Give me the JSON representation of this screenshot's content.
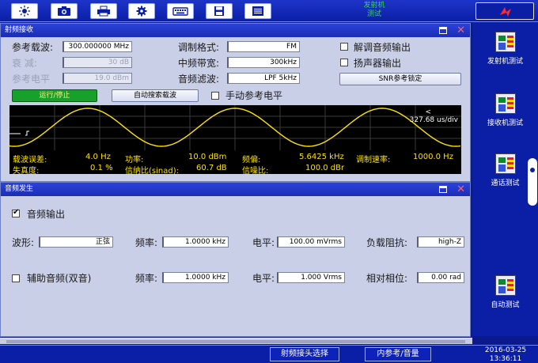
{
  "status": {
    "mode_line1": "发射机",
    "mode_line2": "测试"
  },
  "rx": {
    "title": "射频接收",
    "carrier_label": "参考载波:",
    "carrier_value": "300.000000 MHz",
    "atten_label": "衰  减:",
    "atten_value": "30 dB",
    "reflevel_label": "参考电平",
    "reflevel_value": "19.0 dBm",
    "modfmt_label": "调制格式:",
    "modfmt_value": "FM",
    "ifbw_label": "中频带宽:",
    "ifbw_value": "300kHz",
    "afilter_label": "音频滤波:",
    "afilter_value": "LPF 5kHz",
    "demod_label": "解调音频输出",
    "speaker_label": "扬声器输出",
    "snr_btn": "SNR参考锁定",
    "run_btn": "运行/停止",
    "autosearch_btn": "自动搜索载波",
    "manual_ref_label": "手动参考电平",
    "scope_time": "327.68 us/div",
    "scope_caret": "<",
    "meas": {
      "carrier_err_label": "载波误差:",
      "carrier_err_value": "4.0  Hz",
      "power_label": "功率:",
      "power_value": "10.0 dBm",
      "deviation_label": "频偏:",
      "deviation_value": "5.6425 kHz",
      "modrate_label": "调制速率:",
      "modrate_value": "1000.0  Hz",
      "distortion_label": "失真度:",
      "distortion_value": "0.1 %",
      "sinad_label": "信纳比(sinad):",
      "sinad_value": "60.7 dB",
      "snr_label": "信噪比:",
      "snr_value": "100.0 dBr"
    }
  },
  "ag": {
    "title": "音频发生",
    "audio_out_label": "音频输出",
    "wave_label": "波形:",
    "wave_value": "正弦",
    "freq_label": "频率:",
    "freq_value": "1.0000 kHz",
    "level_label": "电平:",
    "level_value": "100.00 mVrms",
    "load_label": "负载阻抗:",
    "load_value": "high-Z",
    "aux_label": "辅助音频(双音)",
    "aux_freq_label": "频率:",
    "aux_freq_value": "1.0000 kHz",
    "aux_level_label": "电平:",
    "aux_level_value": "1.000  Vrms",
    "phase_label": "相对相位:",
    "phase_value": "0.00 rad"
  },
  "side": {
    "items": [
      {
        "label": "发射机测试"
      },
      {
        "label": "接收机测试"
      },
      {
        "label": "通话测试"
      },
      {
        "label": "自动测试"
      }
    ]
  },
  "bottom": {
    "rf_select": "射频接头选择",
    "ref_qty": "内参考/音量",
    "date": "2016-03-25",
    "time": "13:36:11"
  }
}
